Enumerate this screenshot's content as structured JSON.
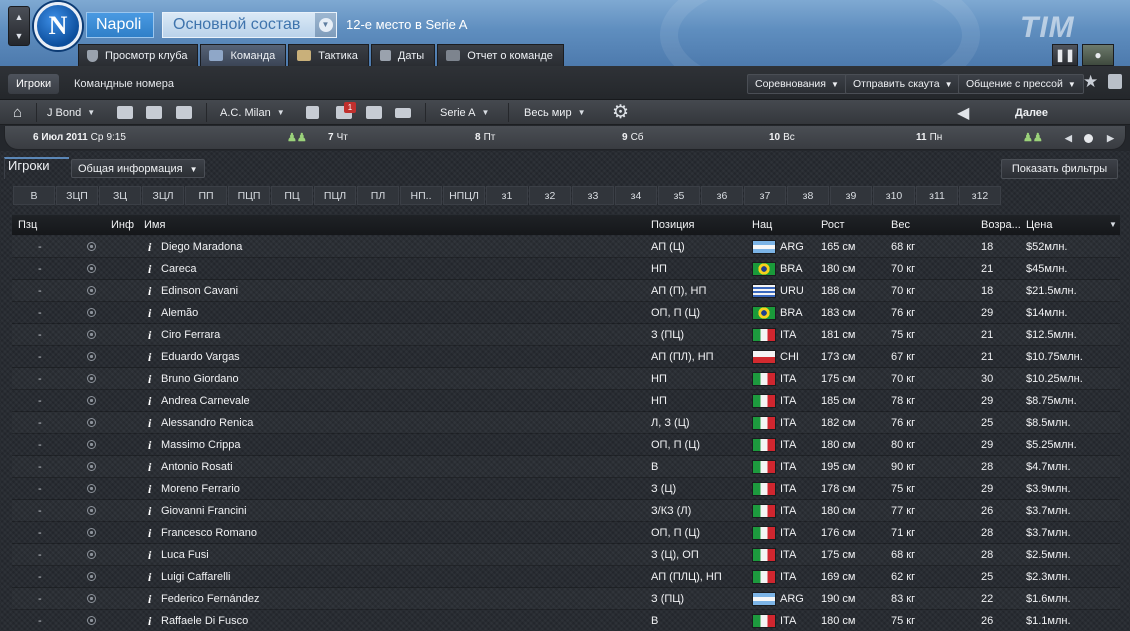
{
  "header": {
    "club_name": "Napoli",
    "crest_letter": "N",
    "view_select": "Основной состав",
    "league_position": "12-е место в Serie A",
    "sponsor": "TIM"
  },
  "nav_tabs": [
    {
      "label": "Просмотр клуба"
    },
    {
      "label": "Команда"
    },
    {
      "label": "Тактика"
    },
    {
      "label": "Даты"
    },
    {
      "label": "Отчет о команде"
    }
  ],
  "subbar": {
    "players_tab": "Игроки",
    "numbers_tab": "Командные номера",
    "competitions": "Соревнования",
    "send_scout": "Отправить скаута",
    "press": "Общение с прессой"
  },
  "toolbar": {
    "manager": "J Bond",
    "next_opponent": "A.C. Milan",
    "messages_count": "1",
    "league": "Serie A",
    "region": "Весь мир",
    "next_label": "Далее"
  },
  "calendar": {
    "date": "6 Июл 2011",
    "weekday": "Ср",
    "time": "9:15",
    "days": [
      {
        "num": "7",
        "wd": "Чт"
      },
      {
        "num": "8",
        "wd": "Пт"
      },
      {
        "num": "9",
        "wd": "Сб"
      },
      {
        "num": "10",
        "wd": "Вс"
      },
      {
        "num": "11",
        "wd": "Пн"
      }
    ]
  },
  "panel": {
    "title": "Игроки",
    "info_select": "Общая информация",
    "filters_button": "Показать фильтры"
  },
  "position_filters": [
    "В",
    "ЗЦП",
    "ЗЦ",
    "ЗЦЛ",
    "ПП",
    "ПЦП",
    "ПЦ",
    "ПЦЛ",
    "ПЛ",
    "НП..",
    "НПЦЛ",
    "з1",
    "з2",
    "з3",
    "з4",
    "з5",
    "з6",
    "з7",
    "з8",
    "з9",
    "з10",
    "з11",
    "з12"
  ],
  "table": {
    "columns": {
      "status": "Пзц",
      "info": "Инф",
      "name": "Имя",
      "position": "Позиция",
      "nationality": "Нац",
      "height": "Рост",
      "weight": "Вес",
      "age": "Возра...",
      "price": "Цена"
    },
    "rows": [
      {
        "status": "-",
        "name": "Diego Maradona",
        "position": "АП (Ц)",
        "nat": "ARG",
        "height": "165 см",
        "weight": "68 кг",
        "age": "18",
        "price": "$52млн."
      },
      {
        "status": "-",
        "name": "Careca",
        "position": "НП",
        "nat": "BRA",
        "height": "180 см",
        "weight": "70 кг",
        "age": "21",
        "price": "$45млн."
      },
      {
        "status": "-",
        "name": "Edinson Cavani",
        "position": "АП (П), НП",
        "nat": "URU",
        "height": "188 см",
        "weight": "70 кг",
        "age": "18",
        "price": "$21.5млн."
      },
      {
        "status": "-",
        "name": "Alemão",
        "position": "ОП, П (Ц)",
        "nat": "BRA",
        "height": "183 см",
        "weight": "76 кг",
        "age": "29",
        "price": "$14млн."
      },
      {
        "status": "-",
        "name": "Ciro Ferrara",
        "position": "З (ПЦ)",
        "nat": "ITA",
        "height": "181 см",
        "weight": "75 кг",
        "age": "21",
        "price": "$12.5млн."
      },
      {
        "status": "-",
        "name": "Eduardo Vargas",
        "position": "АП (ПЛ), НП",
        "nat": "CHI",
        "height": "173 см",
        "weight": "67 кг",
        "age": "21",
        "price": "$10.75млн."
      },
      {
        "status": "-",
        "name": "Bruno Giordano",
        "position": "НП",
        "nat": "ITA",
        "height": "175 см",
        "weight": "70 кг",
        "age": "30",
        "price": "$10.25млн."
      },
      {
        "status": "-",
        "name": "Andrea Carnevale",
        "position": "НП",
        "nat": "ITA",
        "height": "185 см",
        "weight": "78 кг",
        "age": "29",
        "price": "$8.75млн."
      },
      {
        "status": "-",
        "name": "Alessandro Renica",
        "position": "Л, З (Ц)",
        "nat": "ITA",
        "height": "182 см",
        "weight": "76 кг",
        "age": "25",
        "price": "$8.5млн."
      },
      {
        "status": "-",
        "name": "Massimo Crippa",
        "position": "ОП, П (Ц)",
        "nat": "ITA",
        "height": "180 см",
        "weight": "80 кг",
        "age": "29",
        "price": "$5.25млн."
      },
      {
        "status": "-",
        "name": "Antonio Rosati",
        "position": "В",
        "nat": "ITA",
        "height": "195 см",
        "weight": "90 кг",
        "age": "28",
        "price": "$4.7млн."
      },
      {
        "status": "-",
        "name": "Moreno Ferrario",
        "position": "З (Ц)",
        "nat": "ITA",
        "height": "178 см",
        "weight": "75 кг",
        "age": "29",
        "price": "$3.9млн."
      },
      {
        "status": "-",
        "name": "Giovanni Francini",
        "position": "З/КЗ (Л)",
        "nat": "ITA",
        "height": "180 см",
        "weight": "77 кг",
        "age": "26",
        "price": "$3.7млн."
      },
      {
        "status": "-",
        "name": "Francesco Romano",
        "position": "ОП, П (Ц)",
        "nat": "ITA",
        "height": "176 см",
        "weight": "71 кг",
        "age": "28",
        "price": "$3.7млн."
      },
      {
        "status": "-",
        "name": "Luca Fusi",
        "position": "З (Ц), ОП",
        "nat": "ITA",
        "height": "175 см",
        "weight": "68 кг",
        "age": "28",
        "price": "$2.5млн."
      },
      {
        "status": "-",
        "name": "Luigi Caffarelli",
        "position": "АП (ПЛЦ), НП",
        "nat": "ITA",
        "height": "169 см",
        "weight": "62 кг",
        "age": "25",
        "price": "$2.3млн."
      },
      {
        "status": "-",
        "name": "Federico Fernández",
        "position": "З (ПЦ)",
        "nat": "ARG",
        "height": "190 см",
        "weight": "83 кг",
        "age": "22",
        "price": "$1.6млн."
      },
      {
        "status": "-",
        "name": "Raffaele Di Fusco",
        "position": "В",
        "nat": "ITA",
        "height": "180 см",
        "weight": "75 кг",
        "age": "26",
        "price": "$1.1млн."
      }
    ]
  },
  "flags": {
    "ITA": "linear-gradient(90deg,#1d9a3e 0 33%,#f4f4f4 33% 66%,#d0262f 66%)",
    "ARG": "linear-gradient(180deg,#7cb4e6 0 33%,#f7f7f7 33% 66%,#7cb4e6 66%)",
    "BRA": "radial-gradient(circle at 50% 50%,#1f3f8f 0 22%,#f6d21b 23% 45%,#1a9a3a 46%)",
    "URU": "repeating-linear-gradient(180deg,#f4f4f4 0 2px,#3a68bd 2px 4px)",
    "CHI": "linear-gradient(180deg,#f4f4f4 0 50%,#d22a2f 50%)"
  }
}
